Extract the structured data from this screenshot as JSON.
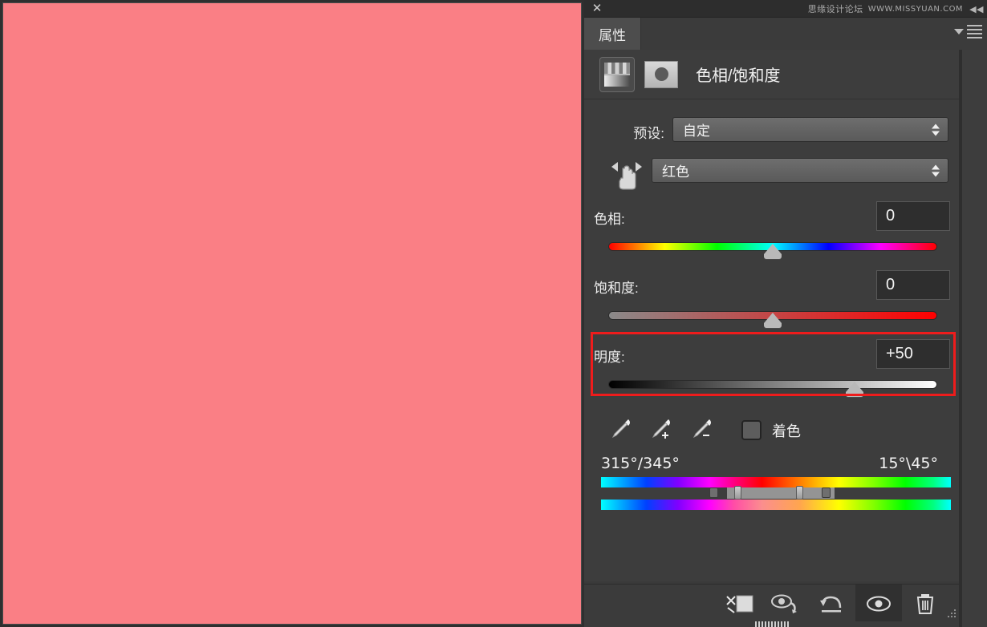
{
  "window": {
    "close_icon": "close-icon",
    "watermark_cn": "思缘设计论坛",
    "watermark_en": "WWW.MISSYUAN.COM",
    "collapse_icon": "collapse-icon"
  },
  "tabs": {
    "properties_label": "属性",
    "menu_icon": "panel-menu-icon"
  },
  "adjustment": {
    "title": "色相/饱和度",
    "layer_icon": "hue-saturation-icon",
    "mask_thumb_icon": "layer-mask-thumbnail"
  },
  "preset": {
    "label": "预设:",
    "value": "自定"
  },
  "channel": {
    "targeted_icon": "targeted-adjustment-hand-icon",
    "value": "红色"
  },
  "sliders": [
    {
      "name": "hue",
      "label": "色相:",
      "value": "0",
      "thumb_percent": 50,
      "highlighted": false
    },
    {
      "name": "saturation",
      "label": "饱和度:",
      "value": "0",
      "thumb_percent": 50,
      "highlighted": false
    },
    {
      "name": "lightness",
      "label": "明度:",
      "value": "+50",
      "thumb_percent": 74,
      "highlighted": true
    }
  ],
  "highlight_color": "#ee1c1c",
  "tools": {
    "eyedropper": "eyedropper-icon",
    "eyedropper_add": "eyedropper-add-icon",
    "eyedropper_subtract": "eyedropper-subtract-icon",
    "colorize_label": "着色",
    "colorize_checked": false
  },
  "range": {
    "left_text": "315°/345°",
    "right_text": "15°\\45°"
  },
  "bottom_toolbar": {
    "clip_to_layer_icon": "clip-to-layer-icon",
    "view_previous_icon": "view-previous-state-icon",
    "reset_icon": "reset-icon",
    "visibility_icon": "toggle-visibility-icon",
    "delete_icon": "delete-layer-icon",
    "visibility_active": true
  },
  "canvas": {
    "fill_color": "#fa7f85"
  }
}
